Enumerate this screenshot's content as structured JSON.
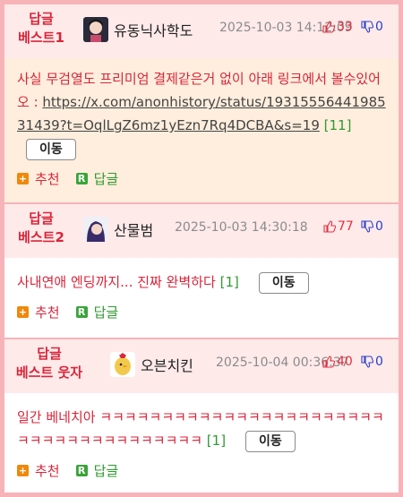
{
  "colors": {
    "accent": "#d9253a",
    "frame": "#f7b4b8",
    "header_bg": "#ffeaea",
    "best1_bg": "#ffeedd",
    "reply_green": "#2f9a2f",
    "down_blue": "#2a40c8"
  },
  "common": {
    "recommend_label": "추천",
    "reply_label": "답글",
    "goto_label": "이동"
  },
  "comments": [
    {
      "rank_line1": "답글",
      "rank_line2": "베스트1",
      "nickname": "유동닉사학도",
      "date": "2025-10-03 14:12:09",
      "up": "33",
      "down": "0",
      "text_before": "사실 무검열도 프리미엄 결제같은거 없이 아래 링크에서 볼수있어오 : ",
      "link": "https://x.com/anonhistory/status/1931555644198531439?t=OqlLgZ6mz1yEzn7Rq4DCBA&s=19",
      "reply_count": "[11]"
    },
    {
      "rank_line1": "답글",
      "rank_line2": "베스트2",
      "nickname": "산물범",
      "date": "2025-10-03 14:30:18",
      "up": "77",
      "down": "0",
      "text": "사내연애 엔딩까지... 진짜 완벽하다",
      "reply_count": "[1]"
    },
    {
      "rank_line1": "답글",
      "rank_line2": "베스트 웃자",
      "nickname": "오븐치킨",
      "date": "2025-10-04 00:36:37",
      "up": "40",
      "down": "0",
      "text": "일간 베네치아 ㅋㅋㅋㅋㅋㅋㅋㅋㅋㅋㅋㅋㅋㅋㅋㅋㅋㅋㅋㅋㅋㅋㅋㅋㅋㅋㅋㅋㅋㅋㅋㅋㅋㅋㅋㅋㅋㅋ",
      "reply_count": "[1]"
    }
  ]
}
